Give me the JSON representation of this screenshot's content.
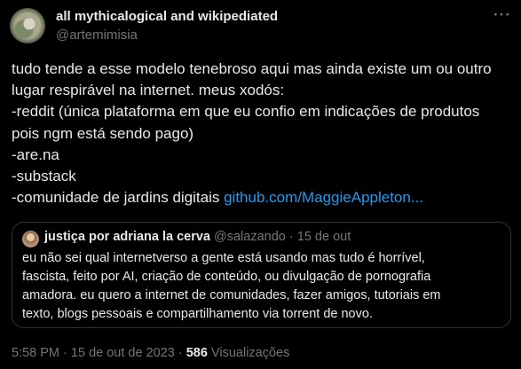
{
  "author": {
    "name": "all mythicalogical and wikipediated",
    "handle": "@artemimisia"
  },
  "more_label": "···",
  "tweet": {
    "lines": [
      "tudo tende a esse modelo tenebroso aqui mas ainda existe um ou outro",
      "lugar respirável na internet. meus xodós:",
      "-reddit (única plataforma em que eu confio em indicações de produtos",
      "pois ngm está sendo pago)",
      "-are.na",
      "-substack"
    ],
    "last_line_text": "-comunidade de jardins digitais ",
    "link_text": "github.com/MaggieAppleton..."
  },
  "quote": {
    "name": "justiça por adriana la cerva",
    "handle": "@salazando",
    "separator": "·",
    "date": "15 de out",
    "lines": [
      "eu não sei qual internetverso a gente está usando mas tudo é horrível,",
      "fascista, feito por AI, criação de conteúdo, ou divulgação de pornografia",
      "amadora.  eu quero a internet de comunidades, fazer amigos, tutoriais em",
      "texto, blogs pessoais e compartilhamento via torrent de novo."
    ]
  },
  "footer": {
    "time": "5:58 PM",
    "separator": "·",
    "date": "15 de out de 2023",
    "views_count": "586",
    "views_label": "Visualizações"
  }
}
